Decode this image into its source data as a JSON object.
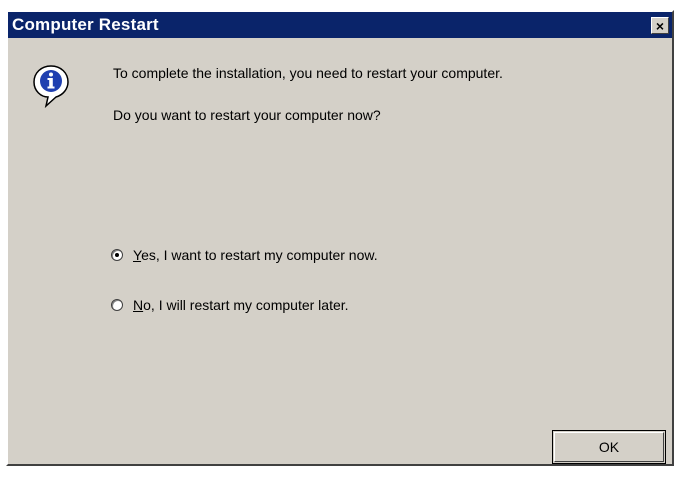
{
  "window": {
    "title": "Computer Restart",
    "close_glyph": "×"
  },
  "message": {
    "icon": "info-icon",
    "line1": "To complete the installation, you need to restart your computer.",
    "line2": "Do you want to restart your computer now?"
  },
  "options": {
    "yes": {
      "mnemonic": "Y",
      "label": "es, I want to restart my computer now.",
      "selected": true
    },
    "no": {
      "mnemonic": "N",
      "label": "o, I will restart my computer later.",
      "selected": false
    }
  },
  "buttons": {
    "ok_label": "OK"
  },
  "colors": {
    "titlebar": "#0a246a",
    "dialog_bg": "#d4d0c8",
    "icon_blue": "#1f3fb0"
  }
}
